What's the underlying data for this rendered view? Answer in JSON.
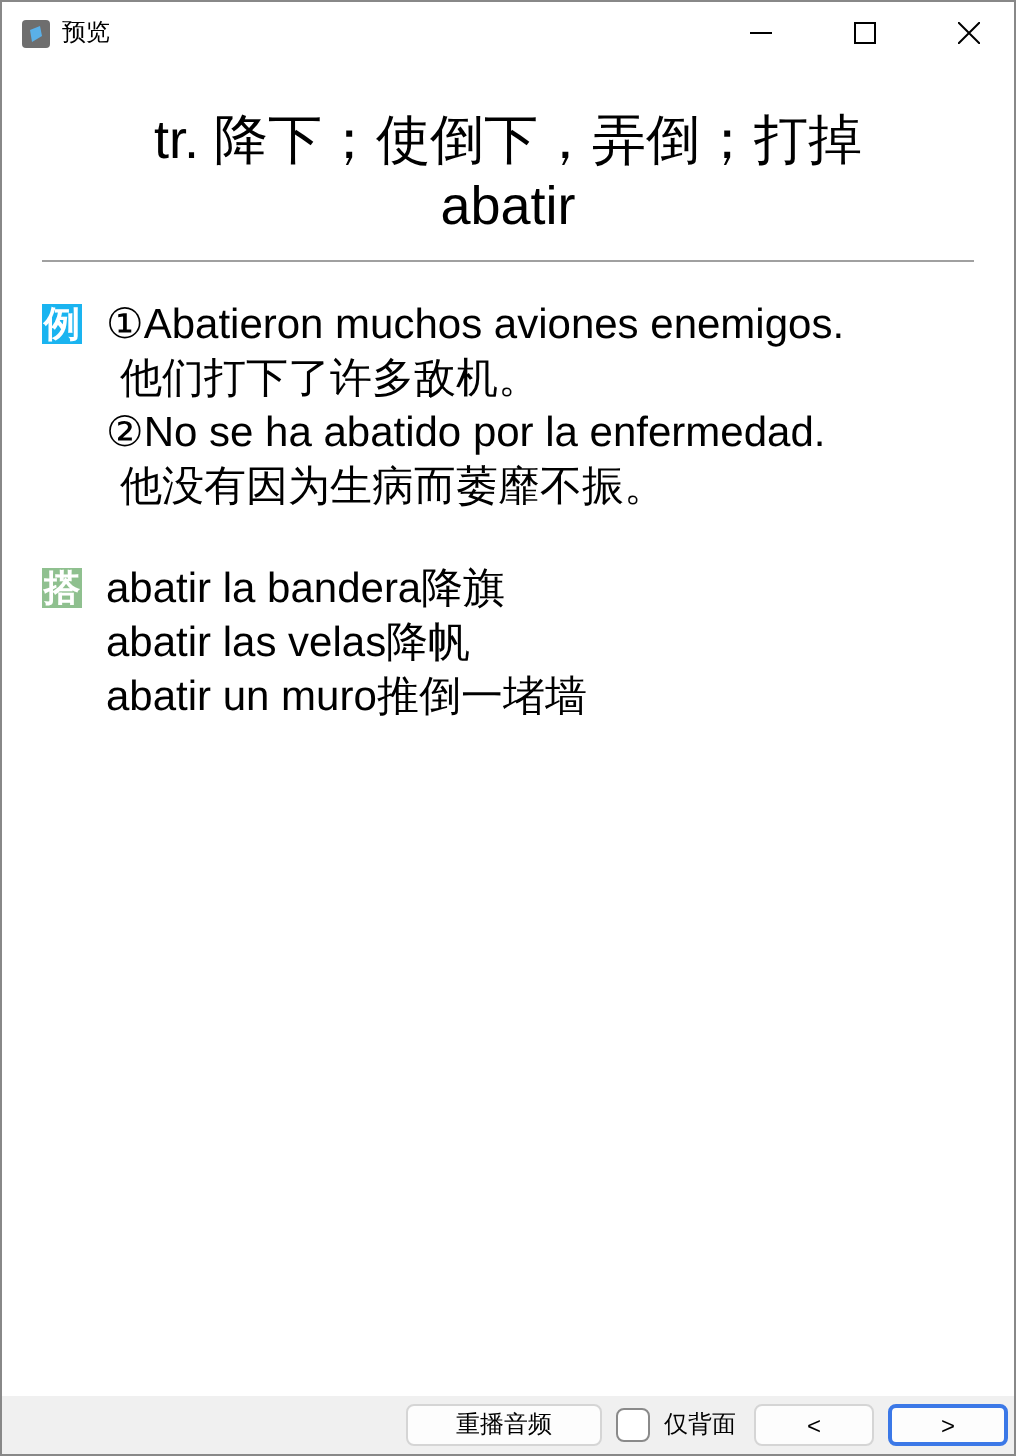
{
  "window": {
    "title": "预览"
  },
  "heading": {
    "definition": "tr. 降下；使倒下，弄倒；打掉",
    "word": "abatir"
  },
  "sections": [
    {
      "badge": "例",
      "color": "#1ab4f0",
      "lines": [
        {
          "kind": "source",
          "text": "①Abatieron muchos aviones enemigos."
        },
        {
          "kind": "translation",
          "text": "他们打下了许多敌机。"
        },
        {
          "kind": "source",
          "text": "②No se ha abatido por la enfermedad."
        },
        {
          "kind": "translation",
          "text": "他没有因为生病而萎靡不振。"
        }
      ]
    },
    {
      "badge": "搭",
      "color": "#8fc08f",
      "lines": [
        {
          "kind": "source",
          "text": "abatir la bandera降旗"
        },
        {
          "kind": "source",
          "text": "abatir las velas降帆"
        },
        {
          "kind": "source",
          "text": "abatir un muro推倒一堵墙"
        }
      ]
    }
  ],
  "footer": {
    "replay": "重播音频",
    "back_only": {
      "label": "仅背面",
      "checked": false
    },
    "prev": "<",
    "next": {
      "label": ">",
      "selected": true
    }
  }
}
